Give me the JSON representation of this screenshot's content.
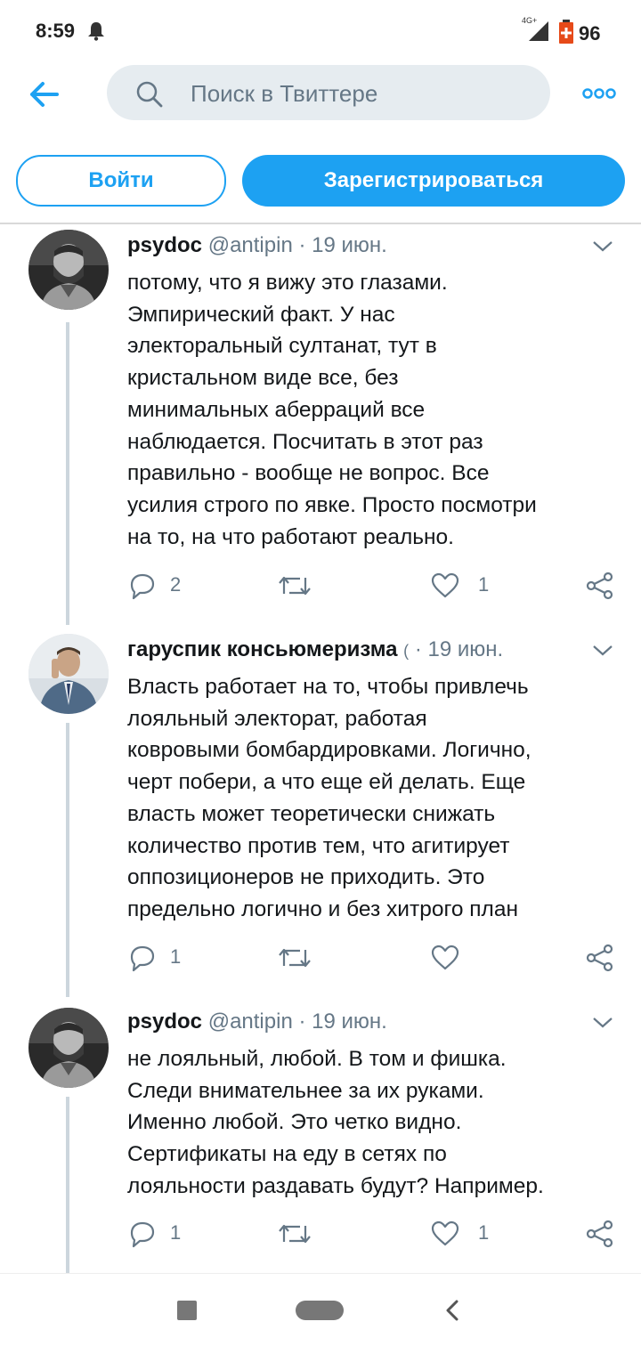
{
  "status": {
    "time": "8:59",
    "network": "4G+",
    "battery": "96"
  },
  "topbar": {
    "search_placeholder": "Поиск в Твиттере"
  },
  "buttons": {
    "login": "Войти",
    "signup": "Зарегистрироваться"
  },
  "tweets": [
    {
      "name": "psydoc",
      "handle": "@antipin",
      "date": "· 19 июн.",
      "text": "потому, что я вижу это глазами.\nЭмпирический факт. У нас\nэлекторальный султанат, тут в\nкристальном виде все, без\nминимальных аберраций все\nнаблюдается. Посчитать в этот раз\nправильно - вообще не вопрос. Все\nусилия строго по явке. Просто посмотри\nна то, на что работают реально.",
      "replies": "2",
      "retweets": "",
      "likes": "1"
    },
    {
      "name": "гаруспик консьюмеризма",
      "handle": "(",
      "date": "· 19 июн.",
      "text": "Власть работает на то, чтобы привлечь\nлояльный электорат, работая\nковровыми бомбардировками. Логично,\nчерт побери, а что еще ей делать. Еще\nвласть может теоретически снижать\nколичество против тем, что агитирует\nоппозиционеров не приходить. Это\nпредельно логично и без хитрого план",
      "replies": "1",
      "retweets": "",
      "likes": ""
    },
    {
      "name": "psydoc",
      "handle": "@antipin",
      "date": "· 19 июн.",
      "text": "не лояльный, любой. В том и фишка.\nСледи внимательнее за их руками.\nИменно любой. Это четко видно.\nСертификаты на еду в сетях по\nлояльности раздавать будут? Например.",
      "replies": "1",
      "retweets": "",
      "likes": "1"
    }
  ],
  "colors": {
    "accent": "#1da1f2",
    "secondary_text": "#657786",
    "thread_line": "#ccd6dd"
  }
}
